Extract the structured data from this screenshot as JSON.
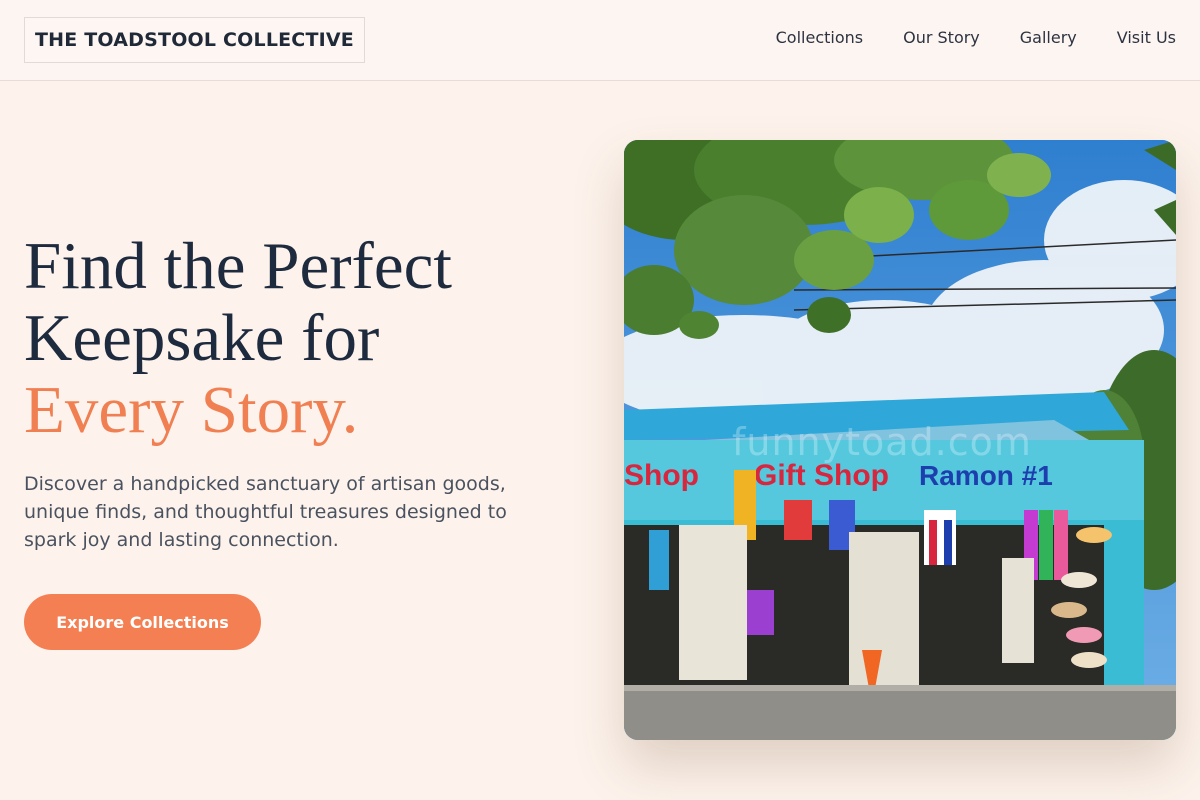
{
  "header": {
    "brand": "THE TOADSTOOL COLLECTIVE",
    "nav": [
      {
        "label": "Collections"
      },
      {
        "label": "Our Story"
      },
      {
        "label": "Gallery"
      },
      {
        "label": "Visit Us"
      }
    ]
  },
  "hero": {
    "headline_line1": "Find the Perfect",
    "headline_line2": "Keepsake for",
    "headline_accent": "Every Story.",
    "description": "Discover a handpicked sanctuary of artisan goods, unique finds, and thoughtful treasures designed to spark joy and lasting connection.",
    "cta_label": "Explore Collections"
  },
  "photo": {
    "signs": {
      "left": "Shop",
      "center": "Gift Shop",
      "right": "Ramon #1"
    },
    "watermark": "funnytoad.com"
  },
  "colors": {
    "accent": "#f47f52",
    "heading": "#1e2a3d",
    "background": "#fdf3ec"
  }
}
